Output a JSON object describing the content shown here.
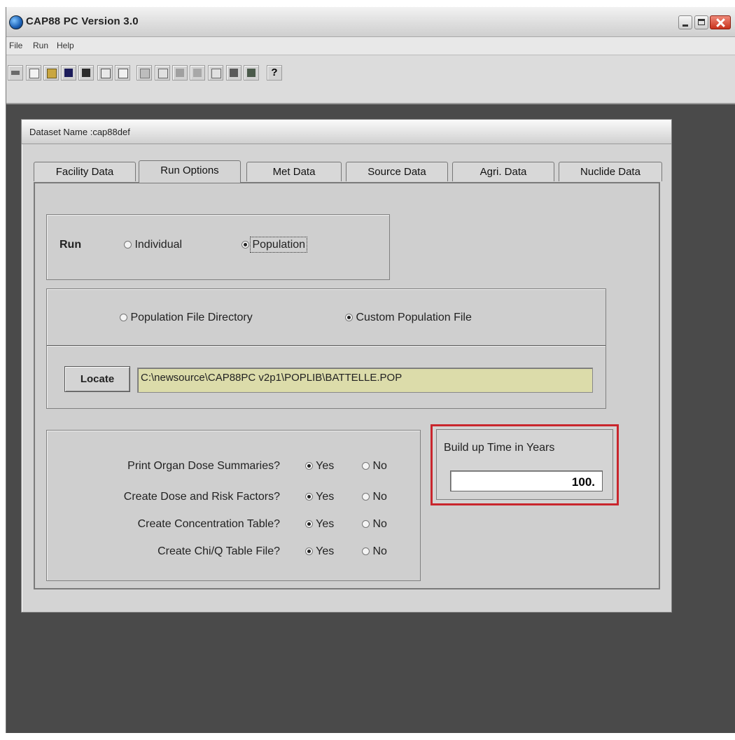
{
  "window": {
    "title": "CAP88 PC Version 3.0",
    "colors": {
      "desktop": "#4a4a4a",
      "close_button": "#c8321c",
      "highlight_border": "#c9262d",
      "path_field_bg": "#dcdcaa"
    }
  },
  "menu": [
    {
      "label": "File"
    },
    {
      "label": "Run"
    },
    {
      "label": "Help"
    }
  ],
  "toolbar": {
    "icons": [
      "exit-icon",
      "new-icon",
      "open-icon",
      "save-icon",
      "folder-icon",
      "report-icon",
      "preview-icon",
      "run-icon",
      "output-icon",
      "dose-icon",
      "risk-icon",
      "table-icon",
      "chart-icon",
      "library-icon",
      "help-icon"
    ],
    "help_label": "?"
  },
  "dialog": {
    "title": "Dataset Name :cap88def",
    "tabs": [
      {
        "label": "Facility Data"
      },
      {
        "label": "Run Options"
      },
      {
        "label": "Met Data"
      },
      {
        "label": "Source Data"
      },
      {
        "label": "Agri. Data"
      },
      {
        "label": "Nuclide Data"
      }
    ],
    "active_tab": "Run Options",
    "run": {
      "label": "Run",
      "options": [
        {
          "label": "Individual",
          "selected": false
        },
        {
          "label": "Population",
          "selected": true
        }
      ]
    },
    "population_source": {
      "options": [
        {
          "label": "Population File Directory",
          "selected": false
        },
        {
          "label": "Custom Population File",
          "selected": true
        }
      ]
    },
    "locate_button": "Locate",
    "path_value": "C:\\newsource\\CAP88PC v2p1\\POPLIB\\BATTELLE.POP",
    "questions": [
      {
        "label": "Print Organ Dose Summaries?",
        "yes": "Yes",
        "no": "No",
        "value": "Yes"
      },
      {
        "label": "Create Dose and Risk Factors?",
        "yes": "Yes",
        "no": "No",
        "value": "Yes"
      },
      {
        "label": "Create Concentration Table?",
        "yes": "Yes",
        "no": "No",
        "value": "Yes"
      },
      {
        "label": "Create Chi/Q Table File?",
        "yes": "Yes",
        "no": "No",
        "value": "Yes"
      }
    ],
    "buildup": {
      "label": "Build up Time in Years",
      "value": "100."
    }
  }
}
